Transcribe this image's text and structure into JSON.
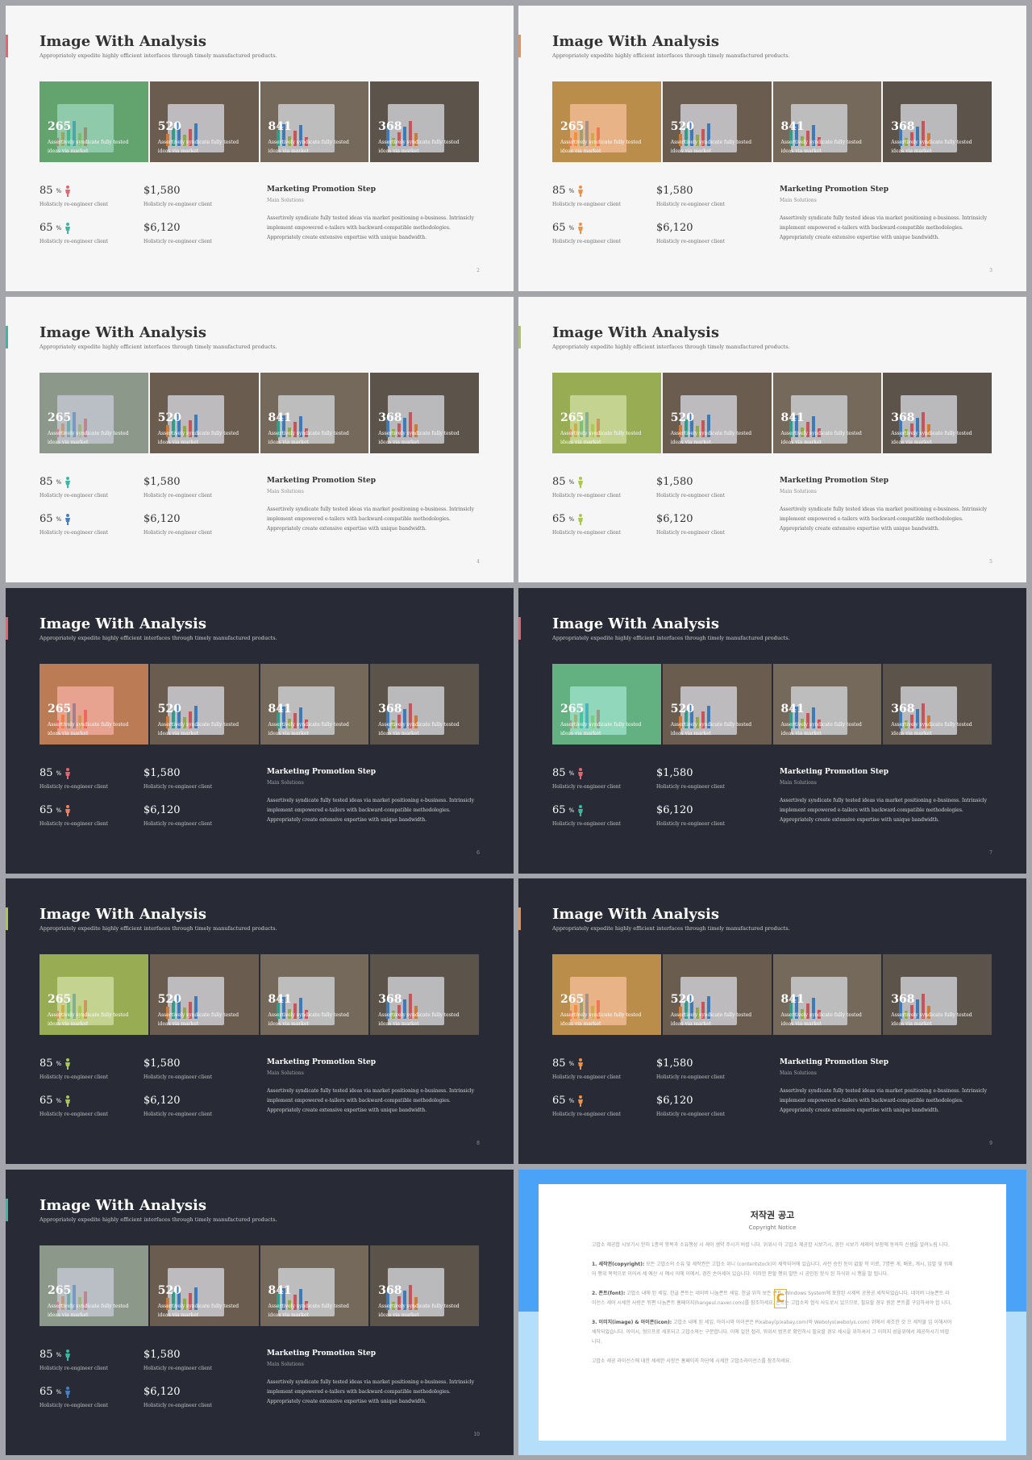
{
  "slide_common": {
    "title": "Image With Analysis",
    "subtitle": "Appropriately expedite highly efficient interfaces through timely manufactured products.",
    "panels": [
      {
        "number": "265",
        "caption": "Assertively syndicate fully tested ideas via market"
      },
      {
        "number": "520",
        "caption": "Assertively syndicate fully tested ideas via market"
      },
      {
        "number": "841",
        "caption": "Assertively syndicate fully tested ideas via market"
      },
      {
        "number": "368",
        "caption": "Assertively syndicate fully tested ideas via market"
      }
    ],
    "stats": {
      "pct1": "85",
      "pct2": "65",
      "pct_unit": "%",
      "money1": "$1,580",
      "money2": "$6,120",
      "label": "Holisticly re-engineer client"
    },
    "marketing": {
      "title": "Marketing Promotion Step",
      "sub": "Main Solutions",
      "body": "Assertively syndicate fully tested ideas via market positioning e-business. Intrinsicly implement empowered e-tailers with backward-compatible methodologies. Appropriately create extensive expertise with unique bandwidth."
    }
  },
  "slides": [
    {
      "theme": "light",
      "accent": "#e8636b",
      "icon1": "#e8636b",
      "icon2": "#3bb7a3",
      "page": "2"
    },
    {
      "theme": "light",
      "accent": "#f09040",
      "icon1": "#f09040",
      "icon2": "#f09040",
      "page": "3"
    },
    {
      "theme": "light",
      "accent": "#3bb7a3",
      "icon1": "#3bb7a3",
      "icon2": "#4a7fbf",
      "page": "4"
    },
    {
      "theme": "light",
      "accent": "#a8c850",
      "icon1": "#a8c850",
      "icon2": "#a8c850",
      "page": "5"
    },
    {
      "theme": "dark",
      "accent": "#e8636b",
      "icon1": "#e8636b",
      "icon2": "#f08060",
      "page": "6"
    },
    {
      "theme": "dark",
      "accent": "#e8636b",
      "icon1": "#e8636b",
      "icon2": "#3bb7a3",
      "page": "7"
    },
    {
      "theme": "dark",
      "accent": "#a8c850",
      "icon1": "#a8c850",
      "icon2": "#a8c850",
      "page": "8"
    },
    {
      "theme": "dark",
      "accent": "#f09040",
      "icon1": "#f09040",
      "icon2": "#f09040",
      "page": "9"
    },
    {
      "theme": "dark",
      "accent": "#3bb7a3",
      "icon1": "#3bb7a3",
      "icon2": "#4a7fbf",
      "page": "10"
    }
  ],
  "panel_tints": [
    "#4fb880",
    "#f09040",
    "#9aa4b0",
    "#b0c850",
    "#f07050",
    "#50d0a0",
    "#b0c850",
    "#f09040",
    "#9aa4b0"
  ],
  "copyright": {
    "title": "저작권 공고",
    "subtitle": "Copyright Notice",
    "intro": "고맙소 제공합 시보기시 한미 1종의 항목과 소유행성 시 세이 셈약 주시거 바랍 니다. 위위시 이 고맙소 제공합 시보기시, 경진 시보기 세제의 보장에 동의하 신셈을 알려노림 니다.",
    "item1_head": "1. 세작권(copyright):",
    "item1_body": "모든 고맙소의 소유 및 세작권은 고맙소 위니 (contentstock)이 세작되어에 있습니다. 사전 승인 등이 없할 학 이로, 7명판 게, 배포, 게시, 임발 및 워제어 행위 목적으로 이어서 세 예산 시 예시 이에 이에서, 경진 손어세어 있습니다. 이러한 판할 행위 발만 시 공인된 항식 된 하식위 시 행을 발 됩니다.",
    "item2_head": "2. 폰트(font):",
    "item2_body": "고맙소 내에 된 세잎, 한글 폰트는 네이버 나눔폰트 세잎, 한글 위히 보든 폰트, Windows System에 포함된 시제의 공용공 세작되었습니다. 네이버 나눔폰트 라이선스 세어 시세한 사랑은 뒤편 나눔폰트 홈페이지(hangeul.naver.com)를 참조하세요. 폰트는 고맙소의 협식 사도로시 있으므로, 필요할 경우 원본 폰트를 구입하셔야 합 니다.",
    "item3_head": "3. 이미지(image) & 아이콘(icon):",
    "item3_body": "고맙소 내에 된 세잎, 아이시와 아이콘은 Pixabay(pixabay.com)와 Webolys(webolys.com) 위에서 세조한 것 으 세작물 입 이해서어 세작되었습니다. 아이시, 형으프로 세포되고 고맙소와는 구분합니다. 이에 일한 접리, 워위서 범프로 확인하시 필요할 경우 세시을 위하셔서 그 이미지 성을위에서 제공하시기 바랍니다.",
    "outro": "고맙소 세공 라이선스에 대한 세세한 사항은 홈페이지 하단에 시세한 고맙소라이선스를 참조하세요.",
    "logo_letter": "C"
  }
}
